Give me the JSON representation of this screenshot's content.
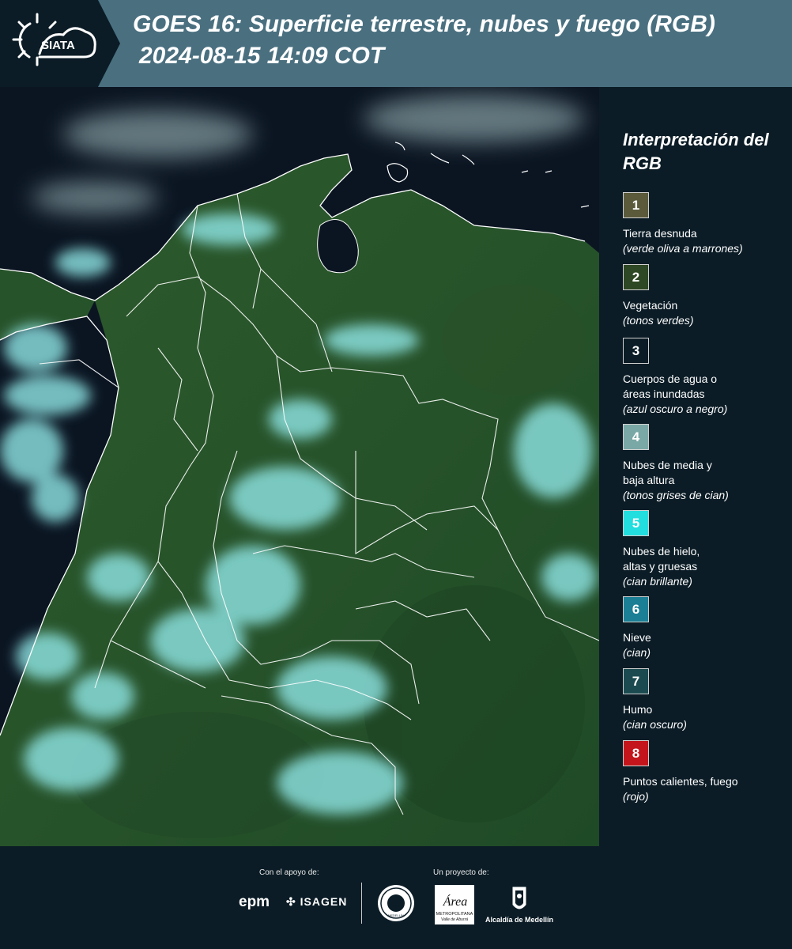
{
  "header": {
    "logo_text": "SIATA",
    "title_line1": "GOES 16: Superficie terrestre, nubes y fuego (RGB)",
    "title_line2": "2024-08-15 14:09 COT"
  },
  "legend": {
    "title": "Interpretación del RGB",
    "items": [
      {
        "number": "1",
        "label": "Tierra desnuda",
        "note": "(verde oliva a marrones)",
        "color": "#5b5b3c"
      },
      {
        "number": "2",
        "label": "Vegetación",
        "note": "(tonos verdes)",
        "color": "#2e4724"
      },
      {
        "number": "3",
        "label": "Cuerpos de agua o\náreas inundadas",
        "note": "(azul oscuro a negro)",
        "color": "#0b1c26"
      },
      {
        "number": "4",
        "label": "Nubes de media y\nbaja altura",
        "note": "(tonos grises de cian)",
        "color": "#7aa8a6"
      },
      {
        "number": "5",
        "label": "Nubes de hielo,\naltas y gruesas",
        "note": "(cian brillante)",
        "color": "#22dede"
      },
      {
        "number": "6",
        "label": "Nieve",
        "note": "(cian)",
        "color": "#1b7f95"
      },
      {
        "number": "7",
        "label": "Humo",
        "note": "(cian oscuro)",
        "color": "#1b4b50"
      },
      {
        "number": "8",
        "label": "Puntos calientes, fuego",
        "note": "(rojo)",
        "color": "#c4151c"
      }
    ]
  },
  "footer": {
    "support_label": "Con el apoyo de:",
    "project_label": "Un proyecto de:",
    "epm": "epm",
    "isagen": "ISAGEN",
    "area_text": "Área",
    "area_sub": "METROPOLITANA",
    "area_sub2": "Valle de Aburrá",
    "seal_text": "MEDELLÍN",
    "alcaldia": "Alcaldía de Medellín"
  }
}
